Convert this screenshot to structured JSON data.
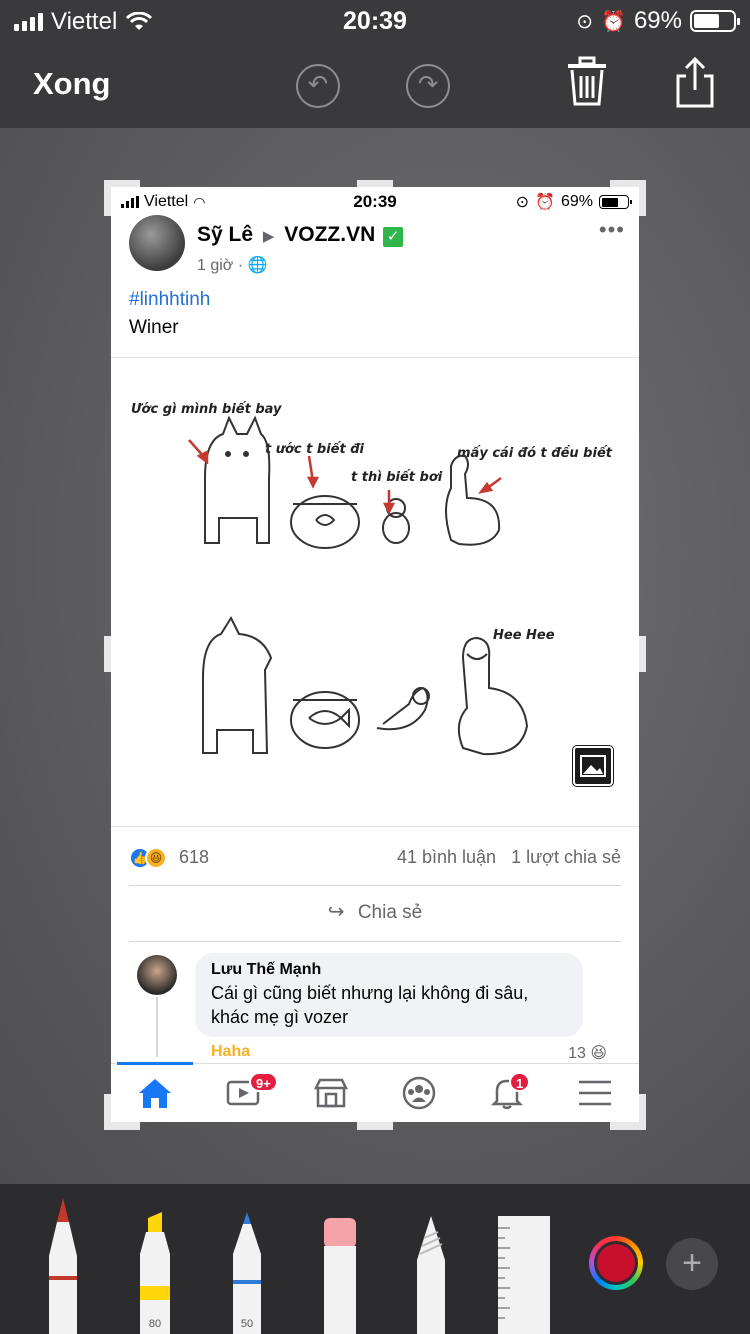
{
  "status_bar": {
    "carrier": "Viettel",
    "time": "20:39",
    "battery": "69%"
  },
  "toolbar_top": {
    "done_label": "Xong",
    "undo_icon": "undo-icon",
    "redo_icon": "redo-icon",
    "trash_icon": "trash-icon",
    "share_icon": "share-icon"
  },
  "screenshot": {
    "status_bar": {
      "carrier": "Viettel",
      "time": "20:39",
      "battery": "69%"
    },
    "post": {
      "author": "Sỹ Lê",
      "group": "VOZZ.VN",
      "time": "1 giờ",
      "hashtag": "#linhhtinh",
      "caption": "Winer",
      "meme_texts": {
        "t1": "Ước gì mình biết bay",
        "t2": "t ước t biết đi",
        "t3": "t thì biết bơi",
        "t4": "mấy cái đó t đều biết",
        "t5": "Hee Hee"
      },
      "reaction_count": "618",
      "comment_count": "41 bình luận",
      "share_count": "1 lượt chia sẻ",
      "share_label": "Chia sẻ"
    },
    "comment": {
      "author": "Lưu Thế Mạnh",
      "text_line1": "Cái gì cũng biết nhưng lại không đi sâu,",
      "text_line2": "khác mẹ gì vozer",
      "reaction_label": "Haha",
      "reaction_count": "13"
    },
    "tabbar": {
      "video_badge": "9+",
      "notification_badge": "1"
    }
  },
  "markup_tools": {
    "highlighter_size": "80",
    "pencil_size": "50",
    "selected_color": "#c8102e"
  }
}
